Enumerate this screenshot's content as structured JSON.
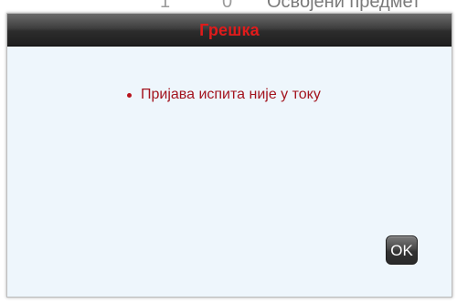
{
  "background": {
    "top_text": "Освојени предмет",
    "mark_one": "1",
    "mark_two": "0"
  },
  "dialog": {
    "title": "Грешка",
    "title_color": "#e01b1b",
    "body_color": "#eef6fc",
    "messages": [
      "Пријава испита није у току"
    ],
    "message_color": "#a3141e",
    "ok_label": "OK"
  },
  "icons": {
    "bullet": "bullet-dot"
  }
}
